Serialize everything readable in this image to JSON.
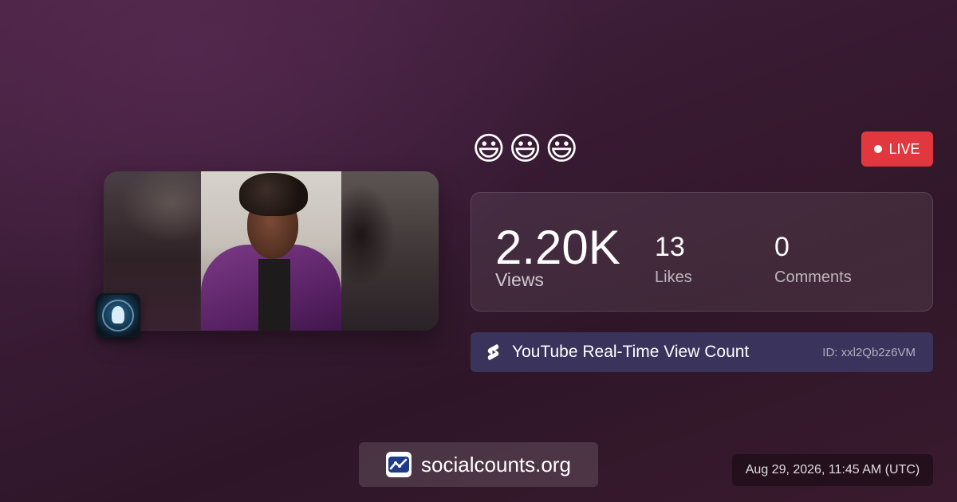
{
  "video": {
    "title": "😃😃😃",
    "thumbnail_icon": "video-thumbnail",
    "channel_avatar_icon": "channel-avatar"
  },
  "badge": {
    "live_label": "LIVE",
    "color": "#e0383e"
  },
  "stats": {
    "views_value": "2.20K",
    "views_label": "Views",
    "likes_value": "13",
    "likes_label": "Likes",
    "comments_value": "0",
    "comments_label": "Comments"
  },
  "service": {
    "icon": "youtube-shorts-icon",
    "label": "YouTube Real-Time View Count",
    "video_id": "ID: xxl2Qb2z6VM"
  },
  "brand": {
    "icon": "socialcounts-logo-icon",
    "name": "socialcounts.org"
  },
  "timestamp": "Aug 29, 2026, 11:45 AM (UTC)"
}
